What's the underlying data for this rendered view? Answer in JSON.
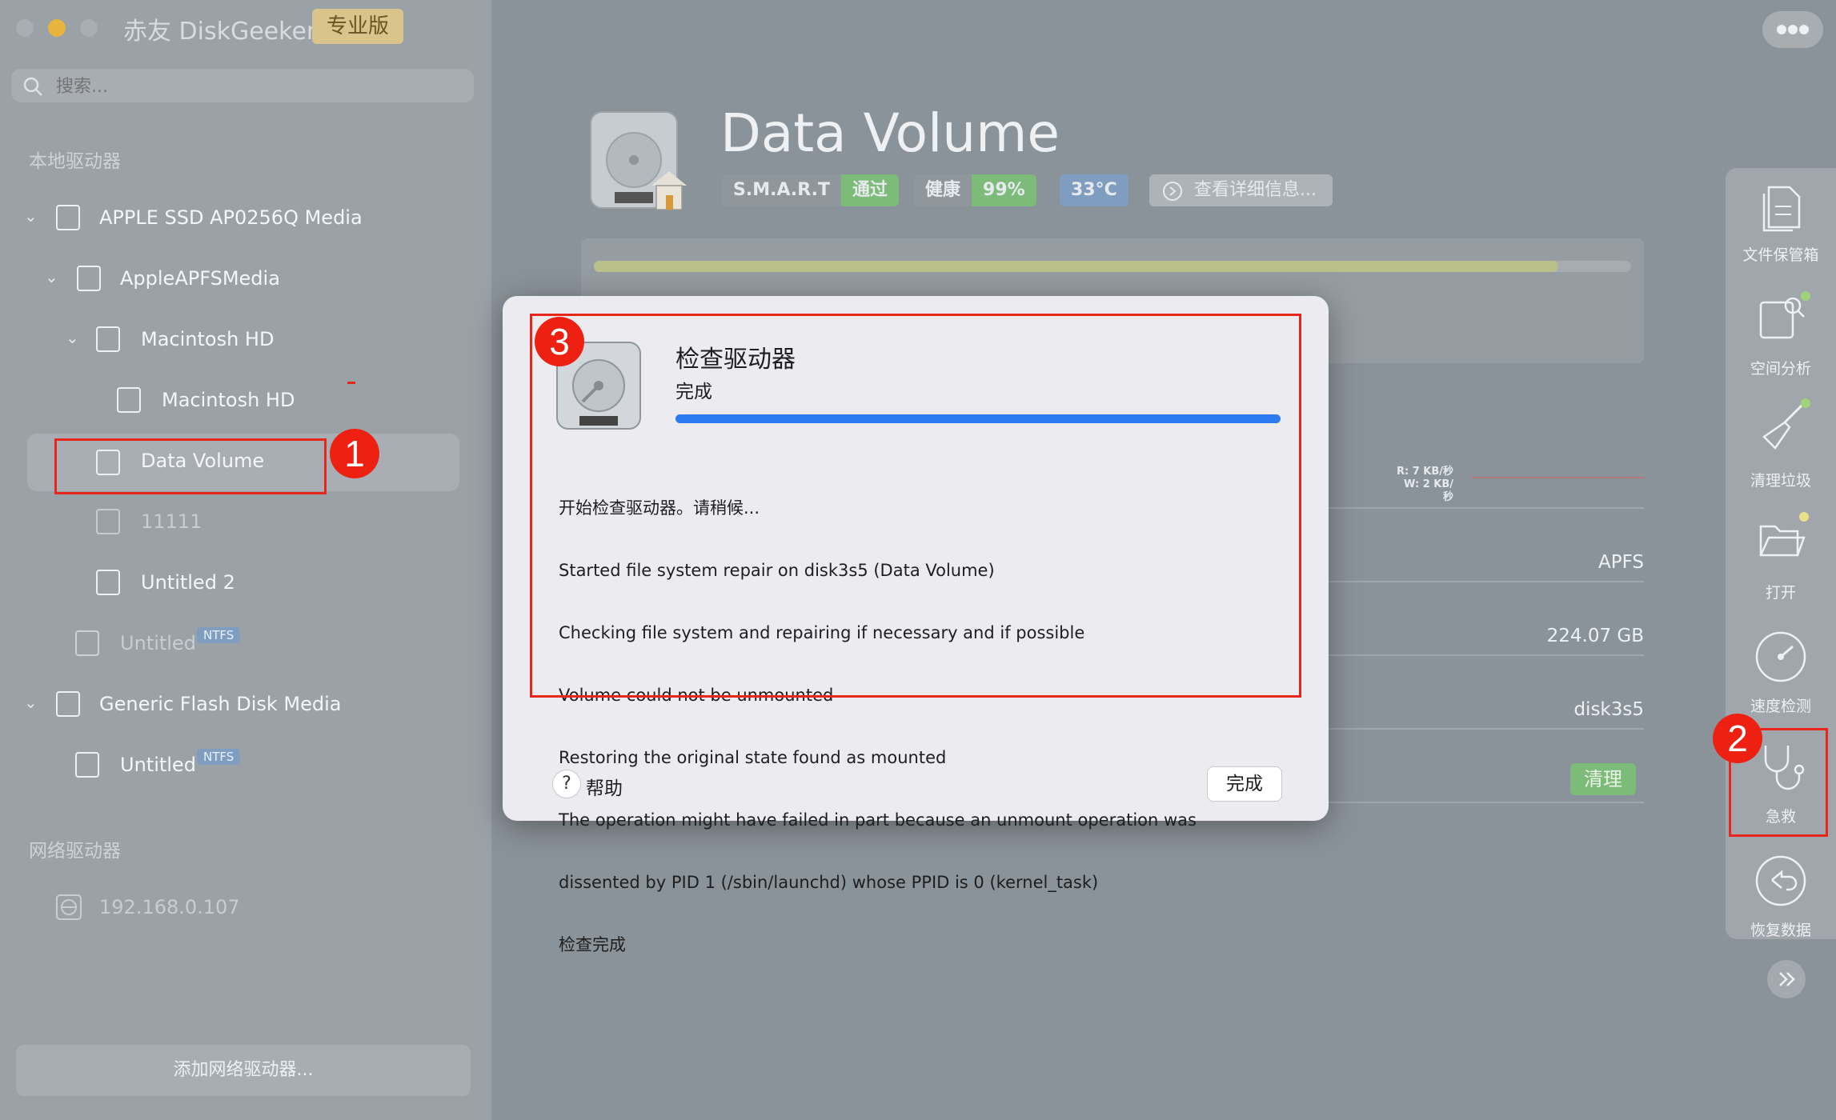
{
  "app": {
    "title": "赤友 DiskGeeker",
    "edition": "专业版"
  },
  "search": {
    "placeholder": "搜索..."
  },
  "sidebar": {
    "local_label": "本地驱动器",
    "network_label": "网络驱动器",
    "items": [
      {
        "label": "APPLE SSD AP0256Q Media"
      },
      {
        "label": "AppleAPFSMedia"
      },
      {
        "label": "Macintosh HD"
      },
      {
        "label": "Macintosh HD"
      },
      {
        "label": "Data Volume"
      },
      {
        "label": "11111"
      },
      {
        "label": "Untitled 2"
      },
      {
        "label": "Untitled",
        "badge": "NTFS"
      },
      {
        "label": "Generic Flash Disk Media"
      },
      {
        "label": "Untitled",
        "badge": "NTFS"
      }
    ],
    "network_items": [
      {
        "label": "192.168.0.107"
      }
    ],
    "add_network_label": "添加网络驱动器..."
  },
  "header": {
    "title": "Data Volume",
    "smart_label": "S.M.A.R.T",
    "smart_status": "通过",
    "health_label": "健康",
    "health_value": "99%",
    "temperature": "33°C",
    "details_label": "查看详细信息...",
    "usage_fraction": 0.93
  },
  "io": {
    "read": "R: 7 KB/秒",
    "write": "W: 2 KB/秒"
  },
  "info_rows": [
    {
      "value": "APFS"
    },
    {
      "value": "224.07 GB"
    },
    {
      "value": "disk3s5"
    },
    {
      "button": "清理"
    }
  ],
  "right_panel": [
    {
      "label": "文件保管箱",
      "icon": "file-vault-icon"
    },
    {
      "label": "空间分析",
      "icon": "space-analysis-icon"
    },
    {
      "label": "清理垃圾",
      "icon": "broom-icon"
    },
    {
      "label": "打开",
      "icon": "folder-open-icon"
    },
    {
      "label": "速度检测",
      "icon": "speedometer-icon"
    },
    {
      "label": "急救",
      "icon": "stethoscope-icon"
    },
    {
      "label": "恢复数据",
      "icon": "restore-icon"
    }
  ],
  "dialog": {
    "title": "检查驱动器",
    "status": "完成",
    "progress": 1.0,
    "log": [
      "开始检查驱动器。请稍候...",
      "Started file system repair on disk3s5 (Data Volume)",
      "Checking file system and repairing if necessary and if possible",
      "Volume could not be unmounted",
      "Restoring the original state found as mounted",
      "The operation might have failed in part because an unmount operation was",
      "dissented by PID 1 (/sbin/launchd) whose PPID is 0 (kernel_task)",
      "检查完成"
    ],
    "help_label": "帮助",
    "done_label": "完成"
  },
  "annotations": {
    "m1": "1",
    "m2": "2",
    "m3": "3"
  },
  "colors": {
    "accent_blue": "#2e7bf0",
    "marker_red": "#ee2012",
    "pass_green": "#7dbb78",
    "temp_blue": "#7f9dc0"
  }
}
